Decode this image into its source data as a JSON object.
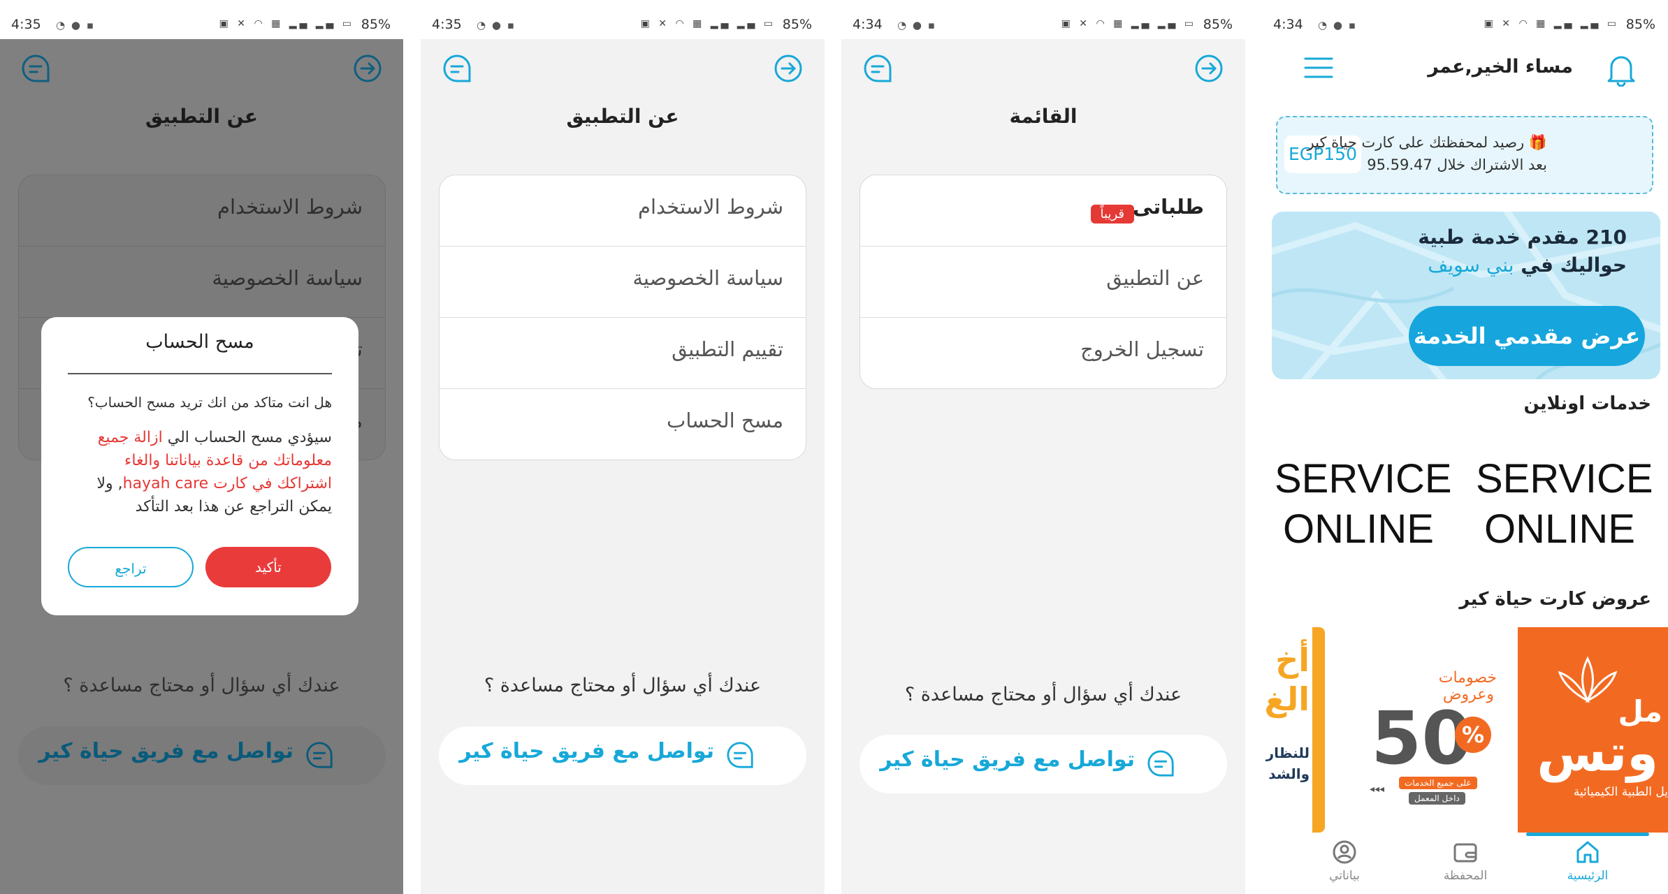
{
  "status_bars": [
    {
      "time": "4:35",
      "battery": "85%"
    },
    {
      "time": "4:35",
      "battery": "85%"
    },
    {
      "time": "4:34",
      "battery": "85%"
    },
    {
      "time": "4:34",
      "battery": "85%"
    }
  ],
  "about_screen": {
    "title": "عن التطبيق",
    "items": [
      "شروط الاستخدام",
      "سياسة الخصوصية",
      "تقييم التطبيق",
      "مسح الحساب"
    ],
    "help_question": "عندك أي سؤال أو محتاج مساعدة ؟",
    "contact_label": "تواصل مع فريق حياة كير"
  },
  "delete_dialog": {
    "title": "مسح الحساب",
    "question": "هل انت متاكد من انك تريد مسح الحساب؟",
    "body_prefix": "سيؤدي مسح الحساب الي",
    "body_red": "ازالة جميع معلوماتك من قاعدة بياناتنا والغاء اشتراكك في كارت hayah care",
    "body_suffix": ", ولا يمكن التراجع عن هذا بعد التأكد",
    "confirm_label": "تأكيد",
    "cancel_label": "تراجع"
  },
  "menu_screen": {
    "title": "القائمة",
    "items": [
      {
        "label": "طلباتى",
        "badge": "قريباً"
      },
      {
        "label": "عن التطبيق"
      },
      {
        "label": "تسجيل الخروج"
      }
    ],
    "help_question": "عندك أي سؤال أو محتاج مساعدة ؟",
    "contact_label": "تواصل مع فريق حياة كير"
  },
  "home_screen": {
    "greeting": "مساء الخير,عمر",
    "balance": {
      "amount": "EGP150",
      "line1": "🎁 رصيد لمحفظتك على كارت حياة كير",
      "line2": "بعد الاشتراك خلال 95.59.47"
    },
    "providers": {
      "line1": "210 مقدم خدمة طبية",
      "line2": "حواليك في",
      "city": "بني سويف",
      "button": "عرض مقدمي الخدمة"
    },
    "online_title": "خدمات اونلاين",
    "services": [
      "SERVICE ONLINE",
      "SERVICE ONLINE"
    ],
    "offers_title": "عروض كارت حياة كير",
    "offers": [
      {
        "lines": [
          "مل",
          "وتس",
          "يل الطبية الكيميائية"
        ]
      },
      {
        "lines": [
          "خصومات",
          "وعروض",
          "50",
          "%",
          "على جميع الخدمات",
          "داخل المعمل"
        ]
      },
      {
        "lines": [
          "أخ",
          "الغ",
          "للنظار",
          "والشد"
        ]
      }
    ],
    "tabs": [
      {
        "label": "الرئيسية",
        "active": true
      },
      {
        "label": "المحفظة",
        "active": false
      },
      {
        "label": "بياناتي",
        "active": false
      }
    ]
  },
  "colors": {
    "accent": "#17a8d8",
    "danger": "#e53935",
    "overlay": "#808080"
  }
}
